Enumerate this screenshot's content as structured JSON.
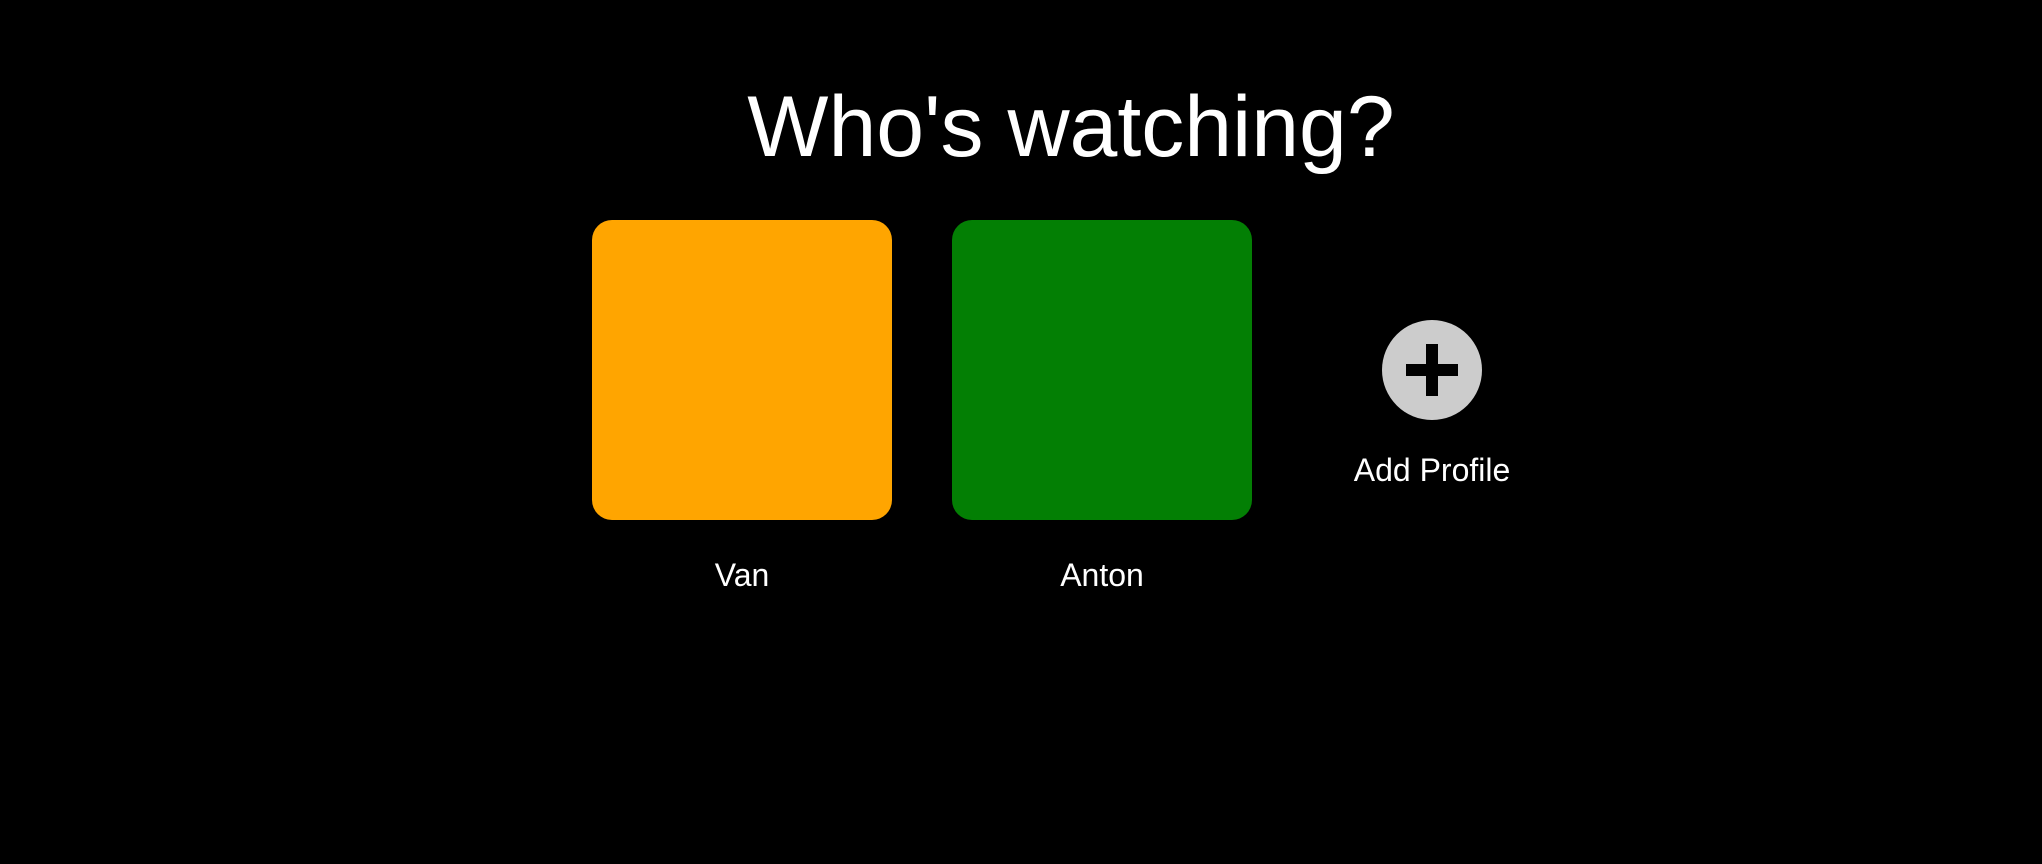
{
  "title": "Who's watching?",
  "profiles": [
    {
      "name": "Van",
      "color": "#FFA500"
    },
    {
      "name": "Anton",
      "color": "#037F04"
    }
  ],
  "add_profile": {
    "label": "Add Profile",
    "icon": "plus-icon",
    "circle_color": "#CCCCCC",
    "icon_color": "#000000"
  }
}
